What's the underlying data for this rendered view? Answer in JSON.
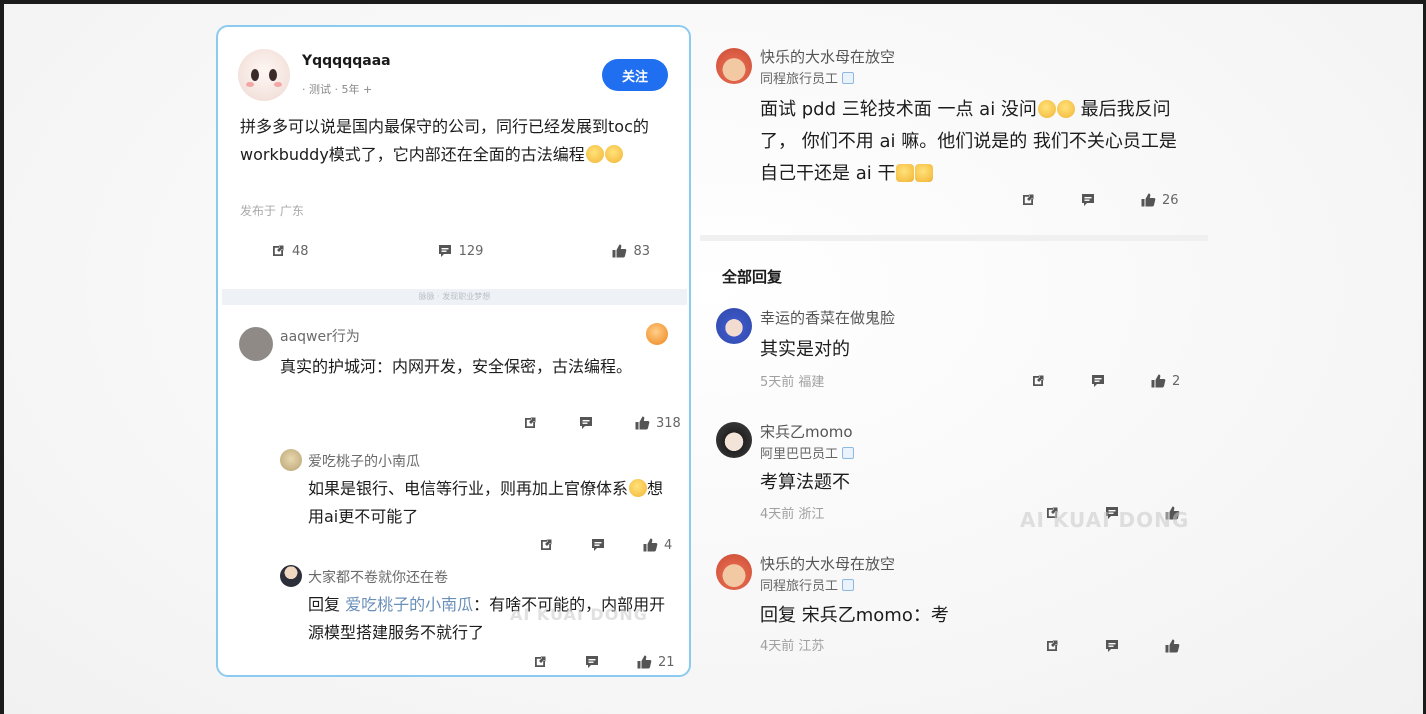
{
  "post": {
    "author": "Yqqqqqaaa",
    "meta": "· 测试 · 5年 +",
    "follow_label": "关注",
    "text": "拼多多可以说是国内最保守的公司，同行已经发展到toc的workbuddy模式了，它内部还在全面的古法编程",
    "location": "发布于 广东",
    "share_count": "48",
    "comment_count": "129",
    "like_count": "83"
  },
  "divider_text": "脉脉 · 发现职业梦想",
  "left_comments": [
    {
      "name": "aaqwer行为",
      "text": "真实的护城河：内网开发，安全保密，古法编程。",
      "like_count": "318"
    },
    {
      "name": "爱吃桃子的小南瓜",
      "text_a": "如果是银行、电信等行业，则再加上官僚体系",
      "text_b": "想用ai更不可能了",
      "like_count": "4"
    },
    {
      "name": "大家都不卷就你还在卷",
      "reply_prefix": "回复",
      "reply_to": "爱吃桃子的小南瓜",
      "text": "：有啥不可能的，内部用开源模型搭建服务不就行了",
      "like_count": "21"
    }
  ],
  "main_comment": {
    "name": "快乐的大水母在放空",
    "tag": "同程旅行员工",
    "text_a": "面试 pdd 三轮技术面 一点 ai 没问",
    "text_b": " 最后我反问了， 你们不用 ai 嘛。他们说是的 我们不关心员工是自己干还是 ai 干",
    "like_count": "26"
  },
  "section_title": "全部回复",
  "replies": [
    {
      "name": "幸运的香菜在做鬼脸",
      "text": "其实是对的",
      "meta": "5天前  福建",
      "like_count": "2"
    },
    {
      "name": "宋兵乙momo",
      "tag": "阿里巴巴员工",
      "text": "考算法题不",
      "meta": "4天前  浙江"
    },
    {
      "name": "快乐的大水母在放空",
      "tag": "同程旅行员工",
      "reply_prefix": "回复",
      "reply_to": "宋兵乙momo",
      "text": "：考",
      "meta": "4天前  江苏"
    }
  ],
  "watermark_right": "AI KUAI DONG",
  "watermark_left": "AI KUAI DONG",
  "colors": {
    "accent": "#1f6ff0",
    "card_border": "#8ccbf0"
  },
  "icons": [
    "share-icon",
    "comment-icon",
    "like-icon"
  ]
}
